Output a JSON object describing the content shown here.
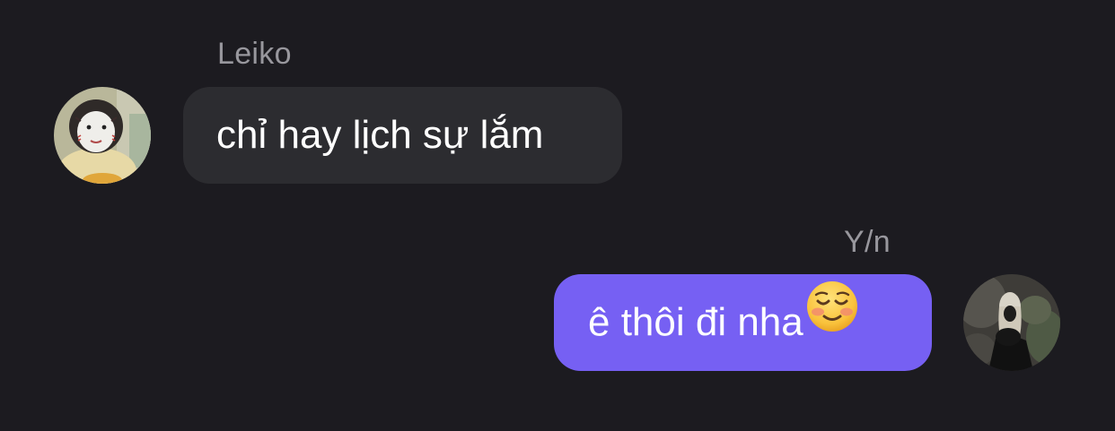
{
  "messages": [
    {
      "sender": "Leiko",
      "text": "chỉ hay lịch sự lắm",
      "direction": "incoming",
      "avatar": "person-avatar"
    },
    {
      "sender": "Y/n",
      "text": "ê thôi đi nha",
      "emoji": "smiling-face-icon",
      "direction": "outgoing",
      "avatar": "person-avatar"
    }
  ],
  "colors": {
    "background": "#1c1b20",
    "incoming_bubble": "#2c2c30",
    "outgoing_bubble": "#7660f3",
    "sender_name": "#98979d",
    "message_text": "#ffffff"
  }
}
